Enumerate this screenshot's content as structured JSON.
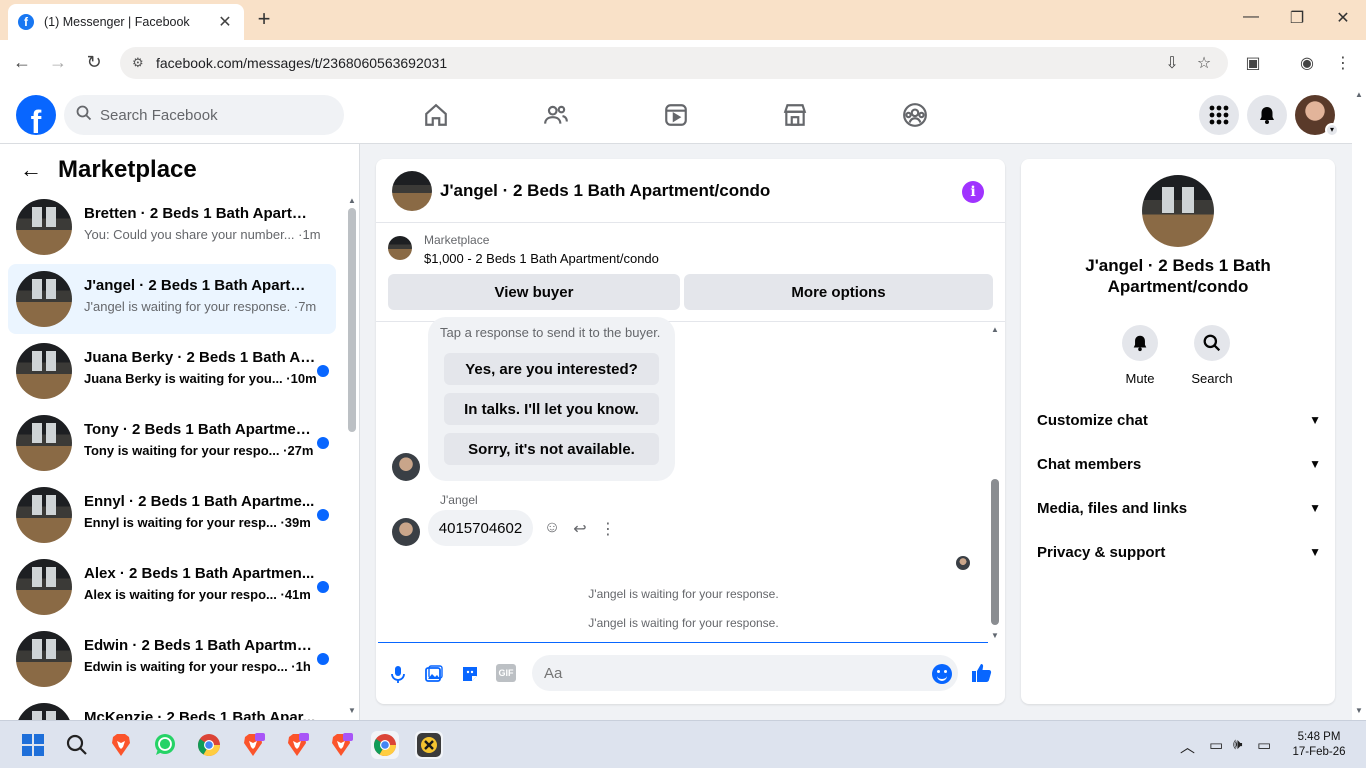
{
  "browser": {
    "tab_title": "(1) Messenger | Facebook",
    "tab_icon": "facebook-favicon",
    "url": "facebook.com/messages/t/2368060563692031"
  },
  "header": {
    "search_placeholder": "Search Facebook",
    "nav_icons": [
      "home-icon",
      "friends-icon",
      "video-icon",
      "marketplace-icon",
      "groups-icon"
    ],
    "right_icons": [
      "menu-grid-icon",
      "notifications-icon",
      "profile-avatar"
    ]
  },
  "sidebar": {
    "title": "Marketplace",
    "conversations": [
      {
        "name": "Bretten · 2 Beds 1 Bath Apartme...",
        "preview": "You: Could you share your number... ·1m",
        "unread": false
      },
      {
        "name": "J'angel · 2 Beds 1 Bath Apartme...",
        "preview": "J'angel is waiting for your response. ·7m",
        "unread": false
      },
      {
        "name": "Juana Berky · 2 Beds 1 Bath Ap...",
        "preview": "Juana Berky is waiting for you... ·10m",
        "unread": true
      },
      {
        "name": "Tony · 2 Beds 1 Bath Apartmen...",
        "preview": "Tony is waiting for your respo... ·27m",
        "unread": true
      },
      {
        "name": "Ennyl · 2 Beds 1 Bath Apartme...",
        "preview": "Ennyl is waiting for your resp... ·39m",
        "unread": true
      },
      {
        "name": "Alex · 2 Beds 1 Bath Apartmen...",
        "preview": "Alex is waiting for your respo... ·41m",
        "unread": true
      },
      {
        "name": "Edwin · 2 Beds 1 Bath Apartme...",
        "preview": "Edwin is waiting for your respo... ·1h",
        "unread": true
      },
      {
        "name": "McKenzie · 2 Beds 1 Bath Apar...",
        "preview": "",
        "unread": false
      }
    ]
  },
  "chat": {
    "title": "J'angel · 2 Beds 1 Bath Apartment/condo",
    "marketplace_label": "Marketplace",
    "listing": "$1,000 - 2 Beds 1 Bath Apartment/condo",
    "view_buyer": "View buyer",
    "more_options": "More options",
    "quick_hint": "Tap a response to send it to the buyer.",
    "quick_replies": [
      "Yes, are you interested?",
      "In talks. I'll let you know.",
      "Sorry, it's not available."
    ],
    "sender": "J'angel",
    "message": "4015704602",
    "status_1": "J'angel is waiting for your response.",
    "status_2": "J'angel is waiting for your response.",
    "composer_placeholder": "Aa"
  },
  "info_panel": {
    "name": "J'angel · 2 Beds 1 Bath Apartment/condo",
    "mute": "Mute",
    "search": "Search",
    "sections": [
      "Customize chat",
      "Chat members",
      "Media, files and links",
      "Privacy & support"
    ]
  },
  "taskbar": {
    "time": "5:48 PM",
    "date": "17-Feb-26"
  },
  "colors": {
    "fb_blue": "#0866ff",
    "tab_bar": "#f9e1c8",
    "info_purple": "#a033ff",
    "active_convo": "#ebf5ff"
  }
}
